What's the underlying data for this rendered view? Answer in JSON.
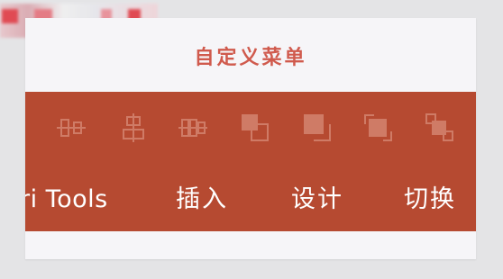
{
  "dialog": {
    "title": "自定义菜单"
  },
  "ribbon": {
    "background": "#b64a31",
    "icon_color": "#cf7b66",
    "icons": [
      "align-middle-icon",
      "align-center-icon",
      "distribute-horizontal-icon",
      "bring-forward-icon",
      "send-backward-icon",
      "bring-to-front-icon",
      "group-objects-icon"
    ],
    "tabs": {
      "tools": "ri Tools",
      "insert": "插入",
      "design": "设计",
      "transitions": "切换"
    }
  },
  "colors": {
    "title": "#d05a4d",
    "card": "#f6f5f8",
    "page": "#e4e4e6"
  }
}
